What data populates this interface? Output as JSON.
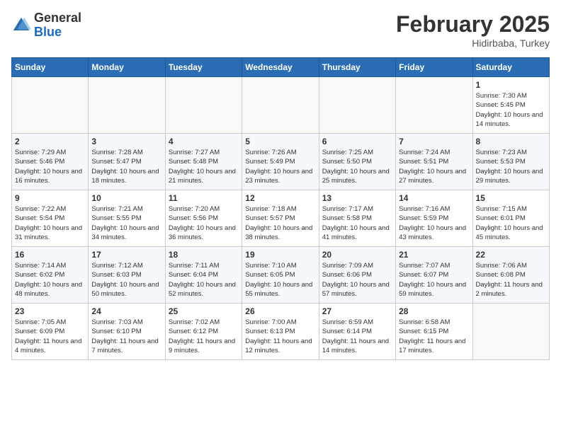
{
  "header": {
    "logo": {
      "general": "General",
      "blue": "Blue"
    },
    "month": "February 2025",
    "location": "Hidirbaba, Turkey"
  },
  "days_of_week": [
    "Sunday",
    "Monday",
    "Tuesday",
    "Wednesday",
    "Thursday",
    "Friday",
    "Saturday"
  ],
  "weeks": [
    [
      {
        "day": "",
        "content": ""
      },
      {
        "day": "",
        "content": ""
      },
      {
        "day": "",
        "content": ""
      },
      {
        "day": "",
        "content": ""
      },
      {
        "day": "",
        "content": ""
      },
      {
        "day": "",
        "content": ""
      },
      {
        "day": "1",
        "content": "Sunrise: 7:30 AM\nSunset: 5:45 PM\nDaylight: 10 hours and 14 minutes."
      }
    ],
    [
      {
        "day": "2",
        "content": "Sunrise: 7:29 AM\nSunset: 5:46 PM\nDaylight: 10 hours and 16 minutes."
      },
      {
        "day": "3",
        "content": "Sunrise: 7:28 AM\nSunset: 5:47 PM\nDaylight: 10 hours and 18 minutes."
      },
      {
        "day": "4",
        "content": "Sunrise: 7:27 AM\nSunset: 5:48 PM\nDaylight: 10 hours and 21 minutes."
      },
      {
        "day": "5",
        "content": "Sunrise: 7:26 AM\nSunset: 5:49 PM\nDaylight: 10 hours and 23 minutes."
      },
      {
        "day": "6",
        "content": "Sunrise: 7:25 AM\nSunset: 5:50 PM\nDaylight: 10 hours and 25 minutes."
      },
      {
        "day": "7",
        "content": "Sunrise: 7:24 AM\nSunset: 5:51 PM\nDaylight: 10 hours and 27 minutes."
      },
      {
        "day": "8",
        "content": "Sunrise: 7:23 AM\nSunset: 5:53 PM\nDaylight: 10 hours and 29 minutes."
      }
    ],
    [
      {
        "day": "9",
        "content": "Sunrise: 7:22 AM\nSunset: 5:54 PM\nDaylight: 10 hours and 31 minutes."
      },
      {
        "day": "10",
        "content": "Sunrise: 7:21 AM\nSunset: 5:55 PM\nDaylight: 10 hours and 34 minutes."
      },
      {
        "day": "11",
        "content": "Sunrise: 7:20 AM\nSunset: 5:56 PM\nDaylight: 10 hours and 36 minutes."
      },
      {
        "day": "12",
        "content": "Sunrise: 7:18 AM\nSunset: 5:57 PM\nDaylight: 10 hours and 38 minutes."
      },
      {
        "day": "13",
        "content": "Sunrise: 7:17 AM\nSunset: 5:58 PM\nDaylight: 10 hours and 41 minutes."
      },
      {
        "day": "14",
        "content": "Sunrise: 7:16 AM\nSunset: 5:59 PM\nDaylight: 10 hours and 43 minutes."
      },
      {
        "day": "15",
        "content": "Sunrise: 7:15 AM\nSunset: 6:01 PM\nDaylight: 10 hours and 45 minutes."
      }
    ],
    [
      {
        "day": "16",
        "content": "Sunrise: 7:14 AM\nSunset: 6:02 PM\nDaylight: 10 hours and 48 minutes."
      },
      {
        "day": "17",
        "content": "Sunrise: 7:12 AM\nSunset: 6:03 PM\nDaylight: 10 hours and 50 minutes."
      },
      {
        "day": "18",
        "content": "Sunrise: 7:11 AM\nSunset: 6:04 PM\nDaylight: 10 hours and 52 minutes."
      },
      {
        "day": "19",
        "content": "Sunrise: 7:10 AM\nSunset: 6:05 PM\nDaylight: 10 hours and 55 minutes."
      },
      {
        "day": "20",
        "content": "Sunrise: 7:09 AM\nSunset: 6:06 PM\nDaylight: 10 hours and 57 minutes."
      },
      {
        "day": "21",
        "content": "Sunrise: 7:07 AM\nSunset: 6:07 PM\nDaylight: 10 hours and 59 minutes."
      },
      {
        "day": "22",
        "content": "Sunrise: 7:06 AM\nSunset: 6:08 PM\nDaylight: 11 hours and 2 minutes."
      }
    ],
    [
      {
        "day": "23",
        "content": "Sunrise: 7:05 AM\nSunset: 6:09 PM\nDaylight: 11 hours and 4 minutes."
      },
      {
        "day": "24",
        "content": "Sunrise: 7:03 AM\nSunset: 6:10 PM\nDaylight: 11 hours and 7 minutes."
      },
      {
        "day": "25",
        "content": "Sunrise: 7:02 AM\nSunset: 6:12 PM\nDaylight: 11 hours and 9 minutes."
      },
      {
        "day": "26",
        "content": "Sunrise: 7:00 AM\nSunset: 6:13 PM\nDaylight: 11 hours and 12 minutes."
      },
      {
        "day": "27",
        "content": "Sunrise: 6:59 AM\nSunset: 6:14 PM\nDaylight: 11 hours and 14 minutes."
      },
      {
        "day": "28",
        "content": "Sunrise: 6:58 AM\nSunset: 6:15 PM\nDaylight: 11 hours and 17 minutes."
      },
      {
        "day": "",
        "content": ""
      }
    ]
  ]
}
